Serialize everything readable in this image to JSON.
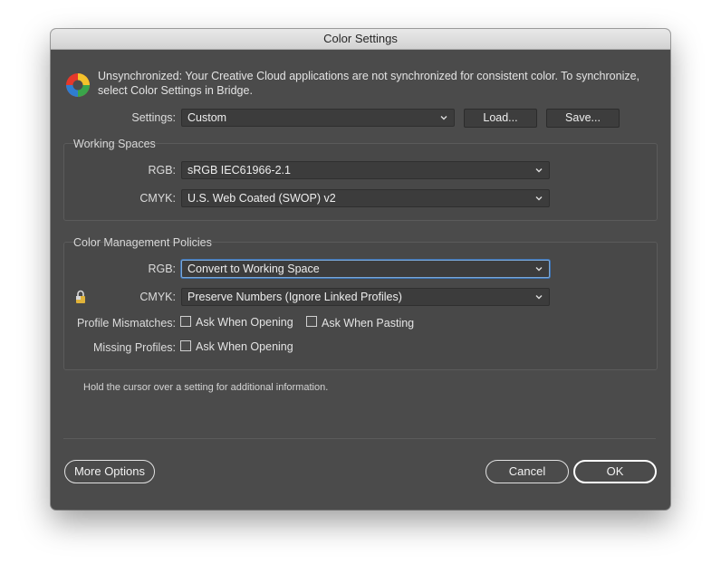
{
  "window": {
    "title": "Color Settings"
  },
  "message": "Unsynchronized: Your Creative Cloud applications are not synchronized for consistent color. To synchronize, select Color Settings in Bridge.",
  "settings": {
    "label": "Settings:",
    "value": "Custom",
    "load_label": "Load...",
    "save_label": "Save..."
  },
  "working_spaces": {
    "title": "Working Spaces",
    "rgb_label": "RGB:",
    "rgb_value": "sRGB IEC61966-2.1",
    "cmyk_label": "CMYK:",
    "cmyk_value": "U.S. Web Coated (SWOP) v2"
  },
  "policies": {
    "title": "Color Management Policies",
    "rgb_label": "RGB:",
    "rgb_value": "Convert to Working Space",
    "cmyk_label": "CMYK:",
    "cmyk_value": "Preserve Numbers (Ignore Linked Profiles)",
    "mismatch_label": "Profile Mismatches:",
    "ask_opening": "Ask When Opening",
    "ask_pasting": "Ask When Pasting",
    "missing_label": "Missing Profiles:",
    "missing_ask_opening": "Ask When Opening"
  },
  "hint": "Hold the cursor over a setting for additional information.",
  "buttons": {
    "more_options": "More Options",
    "cancel": "Cancel",
    "ok": "OK"
  },
  "icons": {
    "sync": "color-sync-icon",
    "lock": "lock-icon",
    "dropdown": "chevron-down-icon"
  },
  "colors": {
    "dialog_bg": "#4b4b4b",
    "focus_ring": "#7aa7d8"
  }
}
